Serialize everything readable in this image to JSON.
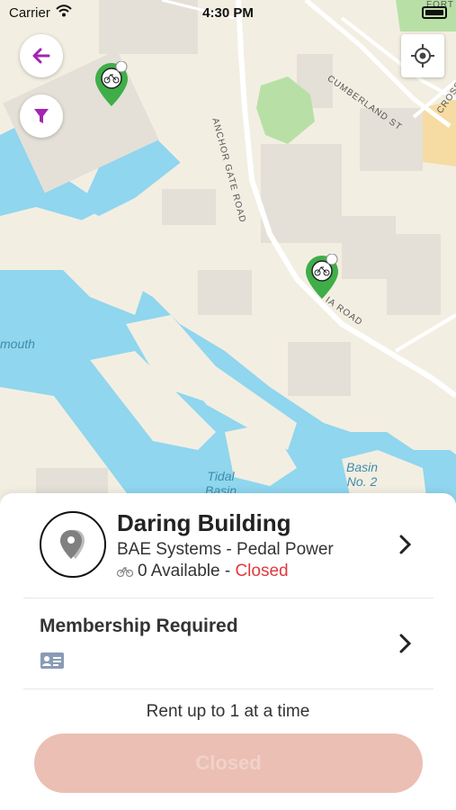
{
  "status_bar": {
    "carrier": "Carrier",
    "time": "4:30 PM"
  },
  "map": {
    "labels": {
      "anchor_gate_road": "ANCHOR GATE ROAD",
      "cumberland_st": "CUMBERLAND ST",
      "cross": "CROSS",
      "fort": "FORT",
      "ia_road": "IA ROAD",
      "mouth": "mouth",
      "tidal_basin_1": "Tidal",
      "tidal_basin_2": "Basin",
      "basin_no2_1": "Basin",
      "basin_no2_2": "No. 2"
    },
    "colors": {
      "water": "#8fd6ee",
      "land": "#f3eee2",
      "building": "#e4e0d8",
      "park": "#b8e0a6",
      "pin": "#3fae49"
    }
  },
  "station": {
    "name": "Daring Building",
    "operator": "BAE Systems - Pedal Power",
    "available_count_text": "0 Available",
    "separator": " - ",
    "status": "Closed"
  },
  "membership": {
    "title": "Membership Required"
  },
  "rental": {
    "limit_text": "Rent up to 1 at a time",
    "button_label": "Closed"
  }
}
